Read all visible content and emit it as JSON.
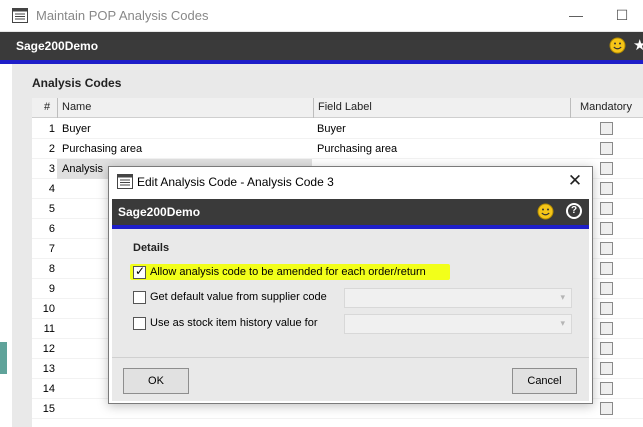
{
  "window": {
    "title": "Maintain POP Analysis Codes",
    "minimize_glyph": "—",
    "maximize_glyph": "☐"
  },
  "brand": {
    "name": "Sage200Demo"
  },
  "section_title": "Analysis Codes",
  "grid": {
    "columns": [
      "#",
      "Name",
      "Field Label",
      "Mandatory"
    ],
    "rows": [
      {
        "num": "1",
        "name": "Buyer",
        "field_label": "Buyer",
        "mandatory": false
      },
      {
        "num": "2",
        "name": "Purchasing area",
        "field_label": "Purchasing area",
        "mandatory": false
      },
      {
        "num": "3",
        "name": "Analysis",
        "field_label": "",
        "mandatory": false
      },
      {
        "num": "4",
        "name": "",
        "field_label": "",
        "mandatory": false
      },
      {
        "num": "5",
        "name": "",
        "field_label": "",
        "mandatory": false
      },
      {
        "num": "6",
        "name": "",
        "field_label": "",
        "mandatory": false
      },
      {
        "num": "7",
        "name": "",
        "field_label": "",
        "mandatory": false
      },
      {
        "num": "8",
        "name": "",
        "field_label": "",
        "mandatory": false
      },
      {
        "num": "9",
        "name": "",
        "field_label": "",
        "mandatory": false
      },
      {
        "num": "10",
        "name": "",
        "field_label": "",
        "mandatory": false
      },
      {
        "num": "11",
        "name": "",
        "field_label": "",
        "mandatory": false
      },
      {
        "num": "12",
        "name": "",
        "field_label": "",
        "mandatory": false
      },
      {
        "num": "13",
        "name": "",
        "field_label": "",
        "mandatory": false
      },
      {
        "num": "14",
        "name": "",
        "field_label": "",
        "mandatory": false
      },
      {
        "num": "15",
        "name": "",
        "field_label": "",
        "mandatory": false
      }
    ]
  },
  "dialog": {
    "title": "Edit Analysis Code - Analysis Code 3",
    "close_glyph": "✕",
    "brand": "Sage200Demo",
    "help_glyph": "?",
    "details_title": "Details",
    "options": [
      {
        "label": "Allow analysis code to be amended for each order/return",
        "checked": true
      },
      {
        "label": "Get default value from supplier code",
        "checked": false
      },
      {
        "label": "Use as stock item history value for",
        "checked": false
      }
    ],
    "combo_arrow": "▾",
    "ok_label": "OK",
    "cancel_label": "Cancel",
    "highlight_color": "#f2ff1a"
  },
  "colors": {
    "brand_bar": "#3a3a3a",
    "accent_blue": "#1e1ec8",
    "smiley": "#f5c518"
  },
  "star_glyph": "★"
}
